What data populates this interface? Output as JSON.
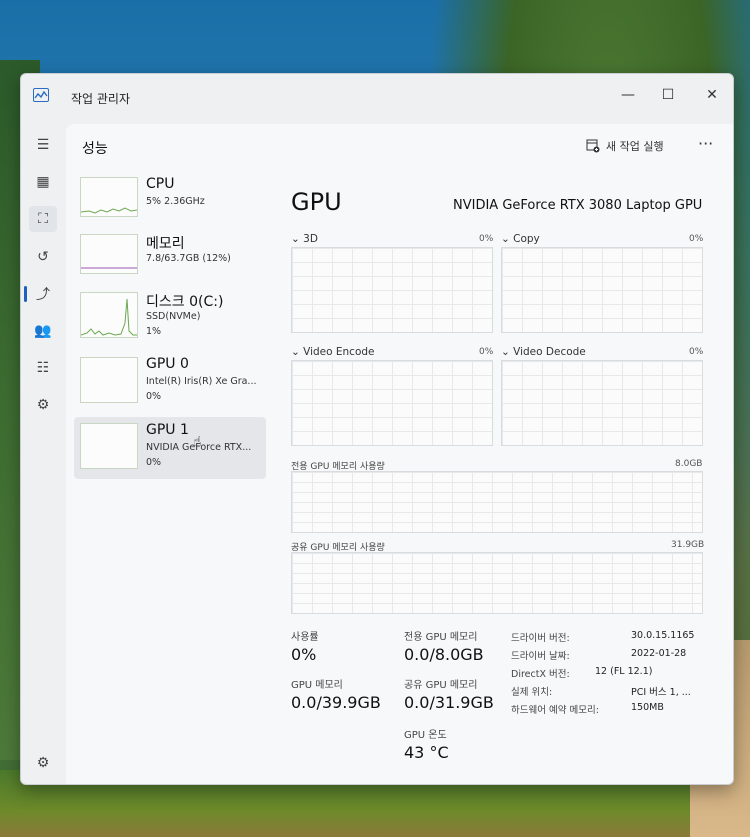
{
  "window": {
    "title": "작업 관리자",
    "minimize": "—",
    "maximize": "☐",
    "close": "✕"
  },
  "nav": [
    {
      "name": "menu-icon",
      "glyph": "☰"
    },
    {
      "name": "processes-icon",
      "glyph": "▦"
    },
    {
      "name": "performance-icon",
      "glyph": "⛶"
    },
    {
      "name": "app-history-icon",
      "glyph": "↺"
    },
    {
      "name": "startup-apps-icon",
      "glyph": "⤴"
    },
    {
      "name": "users-icon",
      "glyph": "👥"
    },
    {
      "name": "details-icon",
      "glyph": "☷"
    },
    {
      "name": "services-icon",
      "glyph": "⚙"
    },
    {
      "name": "settings-icon",
      "glyph": "⚙"
    }
  ],
  "header": {
    "page_title": "성능",
    "run_task": "새 작업 실행",
    "more": "···"
  },
  "sidebar": {
    "items": [
      {
        "name": "CPU",
        "line1": "5% 2.36GHz",
        "line2": ""
      },
      {
        "name": "메모리",
        "line1": "7.8/63.7GB (12%)",
        "line2": ""
      },
      {
        "name": "디스크 0(C:)",
        "line1": "SSD(NVMe)",
        "line2": "1%"
      },
      {
        "name": "GPU 0",
        "line1": "Intel(R) Iris(R) Xe Gra...",
        "line2": "0%"
      },
      {
        "name": "GPU 1",
        "line1": "NVIDIA GeForce RTX...",
        "line2": "0%"
      }
    ]
  },
  "gpu": {
    "title": "GPU",
    "model": "NVIDIA GeForce RTX 3080 Laptop GPU",
    "engines": [
      {
        "label": "3D",
        "value": "0%"
      },
      {
        "label": "Copy",
        "value": "0%"
      },
      {
        "label": "Video Encode",
        "value": "0%"
      },
      {
        "label": "Video Decode",
        "value": "0%"
      }
    ],
    "dedicated_mem": {
      "label": "전용 GPU 메모리 사용량",
      "value": "8.0GB"
    },
    "shared_mem": {
      "label": "공유 GPU 메모리 사용량",
      "value": "31.9GB"
    },
    "stats": {
      "utilization_label": "사용률",
      "utilization_value": "0%",
      "dedicated_label": "전용 GPU 메모리",
      "dedicated_value": "0.0/8.0GB",
      "gpu_mem_label": "GPU 메모리",
      "gpu_mem_value": "0.0/39.9GB",
      "shared_label": "공유 GPU 메모리",
      "shared_value": "0.0/31.9GB",
      "temp_label": "GPU 온도",
      "temp_value": "43 °C"
    },
    "info": [
      {
        "k": "드라이버 버전:",
        "v": "30.0.15.1165"
      },
      {
        "k": "드라이버 날짜:",
        "v": "2022-01-28"
      },
      {
        "k": "DirectX 버전:",
        "v": "12 (FL 12.1)"
      },
      {
        "k": "실제 위치:",
        "v": "PCI 버스 1, ..."
      },
      {
        "k": "하드웨어 예약 메모리:",
        "v": "150MB"
      }
    ]
  },
  "colors": {
    "accent": "#1f5fbf",
    "graph_line": "#6aa84f"
  }
}
